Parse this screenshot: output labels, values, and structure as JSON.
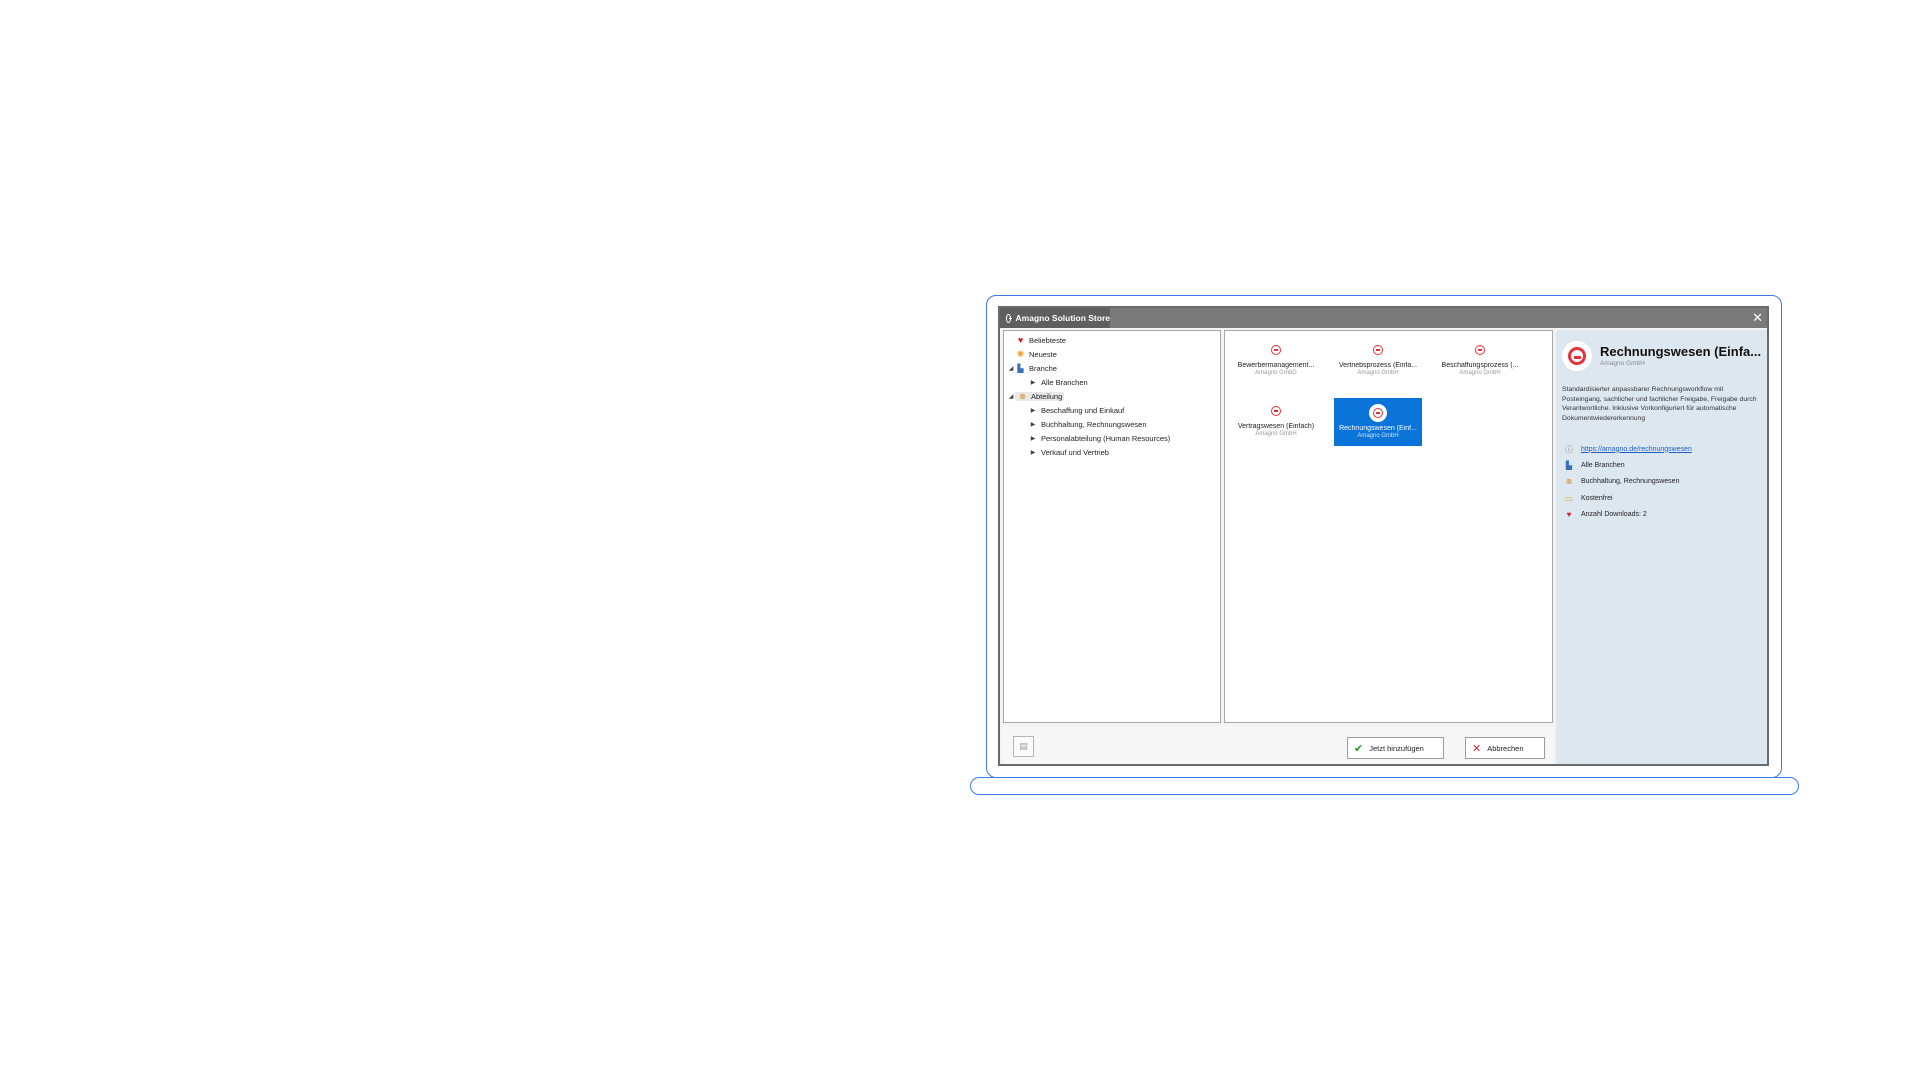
{
  "window": {
    "title": "Amagno Solution Store"
  },
  "tree": {
    "favorites": "Beliebteste",
    "newest": "Neueste",
    "industry": {
      "label": "Branche",
      "children": [
        "Alle Branchen"
      ]
    },
    "department": {
      "label": "Abteilung",
      "children": [
        "Beschaffung und Einkauf",
        "Buchhaltung, Rechnungswesen",
        "Personalabteilung (Human Resources)",
        "Verkauf und Vertrieb"
      ]
    }
  },
  "tiles": [
    {
      "name": "Bewerbermanagement...",
      "vendor": "Amagno GmbG"
    },
    {
      "name": "Vertriebsprozess (Einfa...",
      "vendor": "Amagno GmbH"
    },
    {
      "name": "Beschaffungsprozess (...",
      "vendor": "Amagno GmbH"
    },
    {
      "name": "Vertragswesen (Einfach)",
      "vendor": "Amagno GmbH"
    },
    {
      "name": "Rechnungswesen (Einf...",
      "vendor": "Amagno GmbH"
    }
  ],
  "details": {
    "title": "Rechnungswesen (Einfa...",
    "vendor": "Amagno GmbH",
    "description": "Standardisierter anpassbarer Rechnungsworkflow mit Posteingang, sachlicher und fachlicher Freigabe, Freigabe durch Verantwortliche. Inklusive Vorkonfiguriert für automatische Dokumentwiedererkennung",
    "link": "https://amagno.de/rechnungswesen",
    "industry": "Alle Branchen",
    "department": "Buchhaltung, Rechnungswesen",
    "price": "Kostenfrei",
    "downloads": "Anzahl Downloads: 2"
  },
  "buttons": {
    "add": "Jetzt hinzufügen",
    "cancel": "Abbrechen"
  },
  "colors": {
    "accent": "#0a74d8",
    "brand": "#e5333b",
    "frame": "#3b7bea"
  }
}
